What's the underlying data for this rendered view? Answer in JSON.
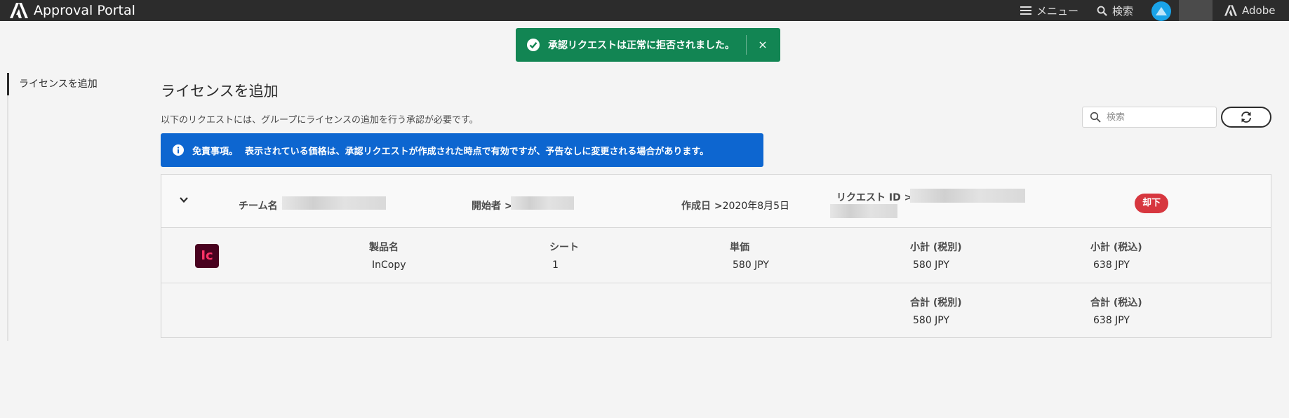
{
  "header": {
    "brand_title": "Approval Portal",
    "menu_label": "メニュー",
    "search_label": "検索",
    "adobe_label": "Adobe"
  },
  "toast": {
    "message": "承認リクエストは正常に拒否されました。",
    "close_label": "×"
  },
  "sidebar": {
    "items": [
      {
        "label": "ライセンスを追加"
      }
    ]
  },
  "main": {
    "title": "ライセンスを追加",
    "description": "以下のリクエストには、グループにライセンスの追加を行う承認が必要です。",
    "search_placeholder": "検索",
    "info": {
      "title": "免責事項。",
      "text": "表示されている価格は、承認リクエストが作成された時点で有効ですが、予告なしに変更される場合があります。"
    }
  },
  "request": {
    "team_label": "チーム名 >",
    "initiator_label": "開始者 >",
    "created_label": "作成日 >",
    "created_value": "2020年8月5日",
    "request_id_label": "リクエスト ID >",
    "status": "却下",
    "columns": {
      "product": "製品名",
      "seats": "シート",
      "unit_price": "単価",
      "subtotal_excl": "小計 (税別)",
      "subtotal_incl": "小計 (税込)",
      "total_excl": "合計 (税別)",
      "total_incl": "合計 (税込)"
    },
    "line": {
      "app_icon_text": "Ic",
      "product": "InCopy",
      "seats": "1",
      "unit_price": "580 JPY",
      "subtotal_excl": "580 JPY",
      "subtotal_incl": "638 JPY"
    },
    "totals": {
      "total_excl": "580 JPY",
      "total_incl": "638 JPY"
    }
  },
  "colors": {
    "topbar": "#2c2c2c",
    "toast_green": "#128553",
    "info_blue": "#0d66d0",
    "reject_red": "#d7373f"
  }
}
